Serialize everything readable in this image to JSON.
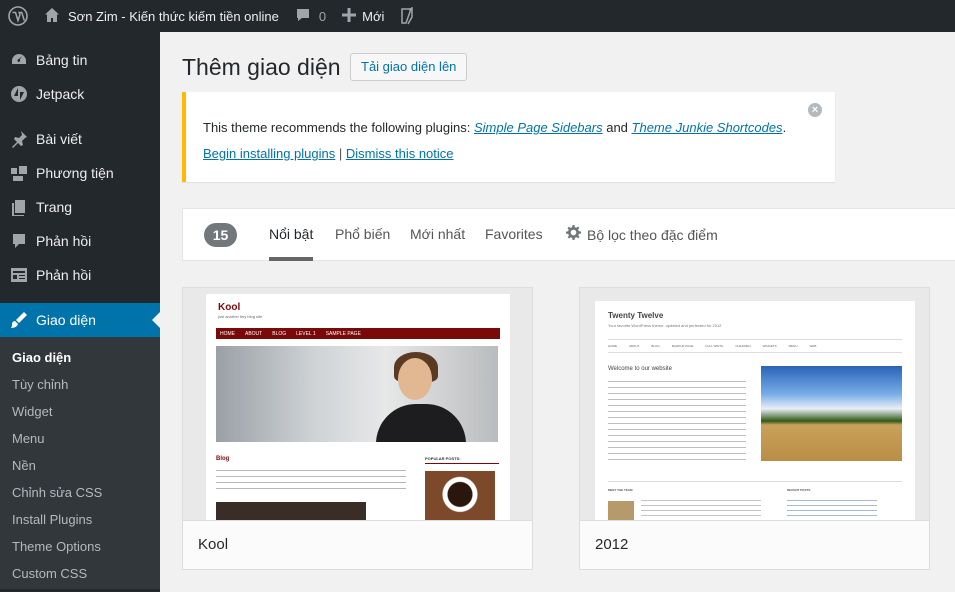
{
  "admin_bar": {
    "site_name": "Sơn Zim - Kiến thức kiếm tiền online",
    "comments_count": "0",
    "new_label": "Mới"
  },
  "sidebar": {
    "items": [
      {
        "label": "Bảng tin",
        "icon": "dashboard-icon"
      },
      {
        "label": "Jetpack",
        "icon": "jetpack-icon"
      },
      {
        "label": "Bài viết",
        "icon": "pin-icon"
      },
      {
        "label": "Phương tiện",
        "icon": "media-icon"
      },
      {
        "label": "Trang",
        "icon": "page-icon"
      },
      {
        "label": "Phản hồi",
        "icon": "comment-icon"
      },
      {
        "label": "Phản hồi",
        "icon": "feedback-icon"
      },
      {
        "label": "Giao diện",
        "icon": "appearance-icon"
      }
    ],
    "submenu": [
      "Giao diện",
      "Tùy chỉnh",
      "Widget",
      "Menu",
      "Nền",
      "Chỉnh sửa CSS",
      "Install Plugins",
      "Theme Options",
      "Custom CSS"
    ]
  },
  "page": {
    "title": "Thêm giao diện",
    "upload_button": "Tải giao diện lên"
  },
  "notice": {
    "prefix": "This theme recommends the following plugins: ",
    "plugin1": "Simple Page Sidebars",
    "and": " and ",
    "plugin2": "Theme Junkie Shortcodes",
    "suffix": ".",
    "install_link": "Begin installing plugins",
    "separator": " | ",
    "dismiss_link": "Dismiss this notice",
    "close_glyph": "×"
  },
  "filters": {
    "count": "15",
    "tabs": [
      "Nổi bật",
      "Phổ biến",
      "Mới nhất",
      "Favorites"
    ],
    "feature_filter": "Bộ lọc theo đặc điểm"
  },
  "themes": [
    {
      "name": "Kool",
      "preview": {
        "title": "Kool",
        "tagline": "just another tiny blog site",
        "nav": [
          "HOME",
          "ABOUT",
          "BLOG",
          "LEVEL 1",
          "SAMPLE PAGE"
        ],
        "section": "Blog",
        "sidebar_heading": "POPULAR POSTS:"
      }
    },
    {
      "name": "2012",
      "preview": {
        "title": "Twenty Twelve",
        "tagline": "Your favorite WordPress theme, updated and perfected for 2012.",
        "nav": [
          "HOME",
          "ABOUT",
          "BLOG",
          "MARKUP PAGE",
          "FULL WIDTH",
          "CHILDREN",
          "WIDGETS",
          "MENU",
          "WEB"
        ],
        "welcome": "Welcome to our website",
        "footer_left": "MEET THE TEAM",
        "footer_right": "RECENT POSTS"
      }
    }
  ]
}
